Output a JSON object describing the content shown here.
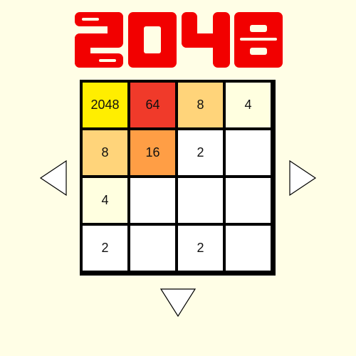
{
  "title": {
    "text": "2048",
    "color": "#f20000"
  },
  "board": {
    "rows": [
      [
        "2048",
        "64",
        "8",
        "4"
      ],
      [
        "8",
        "16",
        "2",
        ""
      ],
      [
        "4",
        "",
        "",
        ""
      ],
      [
        "2",
        "",
        "2",
        ""
      ]
    ]
  },
  "tile_colors": {
    "": "#ffffff",
    "2": "#ffffff",
    "4": "#ffffe0",
    "8": "#ffd47a",
    "16": "#ff9e45",
    "64": "#f03a2a",
    "2048": "#ffee00"
  },
  "controls": {
    "left": "left-arrow-icon",
    "right": "right-arrow-icon",
    "down": "down-arrow-icon"
  }
}
